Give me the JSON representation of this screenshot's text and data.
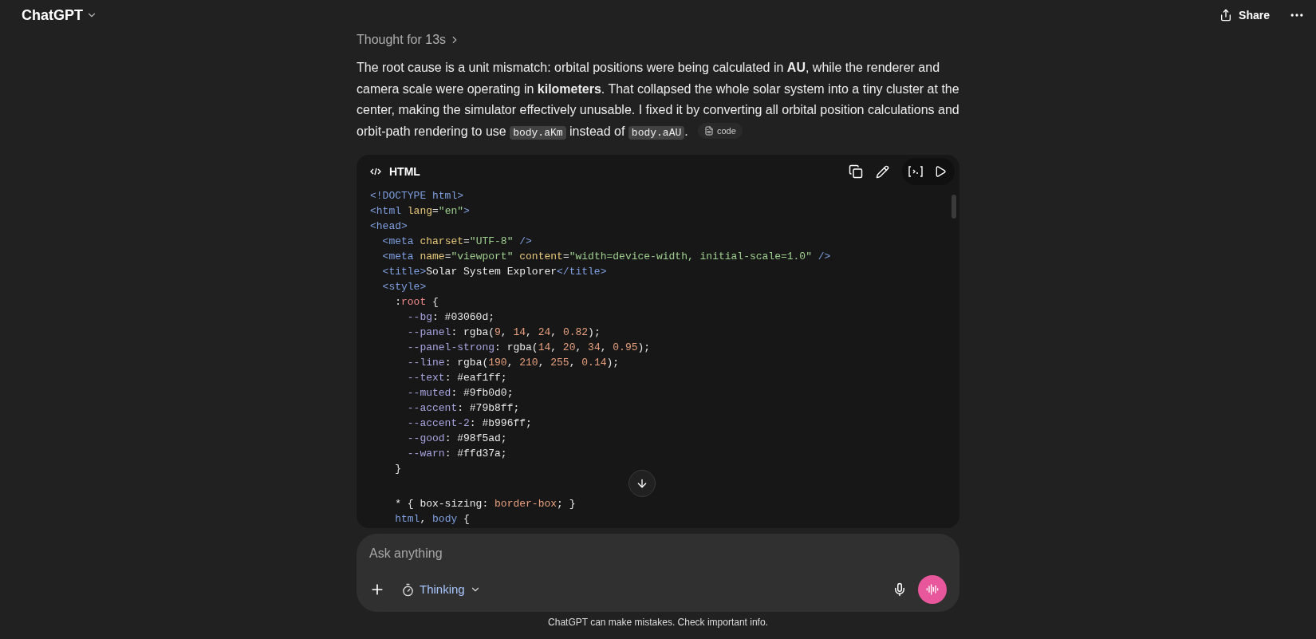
{
  "header": {
    "title": "ChatGPT",
    "share_label": "Share"
  },
  "thought": {
    "label": "Thought for 13s"
  },
  "answer": {
    "segments": [
      {
        "kind": "text",
        "text": "The root cause is a unit mismatch: orbital positions were being calculated in **AU**, while the renderer and camera scale were operating in **kilometers**. That collapsed the whole solar system into a tiny cluster at the center, making the simulator effectively unusable. I fixed it by converting all orbital position calculations and orbit-path rendering to use "
      },
      {
        "kind": "code",
        "text": "body.aKm"
      },
      {
        "kind": "text",
        "text": " instead of "
      },
      {
        "kind": "code",
        "text": "body.aAU"
      },
      {
        "kind": "text",
        "text": "."
      }
    ],
    "source_chip": "code"
  },
  "code_block": {
    "language": "HTML",
    "lines": [
      [
        {
          "kind": "tag",
          "t": "<!DOCTYPE html>"
        }
      ],
      [
        {
          "kind": "tag",
          "t": "<html "
        },
        {
          "kind": "attr",
          "t": "lang"
        },
        {
          "kind": "plain",
          "t": "="
        },
        {
          "kind": "str",
          "t": "\"en\""
        },
        {
          "kind": "tag",
          "t": ">"
        }
      ],
      [
        {
          "kind": "tag",
          "t": "<head>"
        }
      ],
      [
        {
          "kind": "tag",
          "t": "  <meta "
        },
        {
          "kind": "attr",
          "t": "charset"
        },
        {
          "kind": "plain",
          "t": "="
        },
        {
          "kind": "str",
          "t": "\"UTF-8\""
        },
        {
          "kind": "tag",
          "t": " />"
        }
      ],
      [
        {
          "kind": "tag",
          "t": "  <meta "
        },
        {
          "kind": "attr",
          "t": "name"
        },
        {
          "kind": "plain",
          "t": "="
        },
        {
          "kind": "str",
          "t": "\"viewport\""
        },
        {
          "kind": "attr",
          "t": " content"
        },
        {
          "kind": "plain",
          "t": "="
        },
        {
          "kind": "str",
          "t": "\"width=device-width, initial-scale=1.0\""
        },
        {
          "kind": "tag",
          "t": " />"
        }
      ],
      [
        {
          "kind": "tag",
          "t": "  <title>"
        },
        {
          "kind": "plain",
          "t": "Solar System Explorer"
        },
        {
          "kind": "tag",
          "t": "</title>"
        }
      ],
      [
        {
          "kind": "tag",
          "t": "  <style>"
        }
      ],
      [
        {
          "kind": "plain",
          "t": "    :"
        },
        {
          "kind": "sel",
          "t": "root"
        },
        {
          "kind": "plain",
          "t": " {"
        }
      ],
      [
        {
          "kind": "prop",
          "t": "      --bg"
        },
        {
          "kind": "plain",
          "t": ": #03060d;"
        }
      ],
      [
        {
          "kind": "prop",
          "t": "      --panel"
        },
        {
          "kind": "plain",
          "t": ": rgba("
        },
        {
          "kind": "num",
          "t": "9"
        },
        {
          "kind": "plain",
          "t": ", "
        },
        {
          "kind": "num",
          "t": "14"
        },
        {
          "kind": "plain",
          "t": ", "
        },
        {
          "kind": "num",
          "t": "24"
        },
        {
          "kind": "plain",
          "t": ", "
        },
        {
          "kind": "num",
          "t": "0.82"
        },
        {
          "kind": "plain",
          "t": ");"
        }
      ],
      [
        {
          "kind": "prop",
          "t": "      --panel-strong"
        },
        {
          "kind": "plain",
          "t": ": rgba("
        },
        {
          "kind": "num",
          "t": "14"
        },
        {
          "kind": "plain",
          "t": ", "
        },
        {
          "kind": "num",
          "t": "20"
        },
        {
          "kind": "plain",
          "t": ", "
        },
        {
          "kind": "num",
          "t": "34"
        },
        {
          "kind": "plain",
          "t": ", "
        },
        {
          "kind": "num",
          "t": "0.95"
        },
        {
          "kind": "plain",
          "t": ");"
        }
      ],
      [
        {
          "kind": "prop",
          "t": "      --line"
        },
        {
          "kind": "plain",
          "t": ": rgba("
        },
        {
          "kind": "num",
          "t": "190"
        },
        {
          "kind": "plain",
          "t": ", "
        },
        {
          "kind": "num",
          "t": "210"
        },
        {
          "kind": "plain",
          "t": ", "
        },
        {
          "kind": "num",
          "t": "255"
        },
        {
          "kind": "plain",
          "t": ", "
        },
        {
          "kind": "num",
          "t": "0.14"
        },
        {
          "kind": "plain",
          "t": ");"
        }
      ],
      [
        {
          "kind": "prop",
          "t": "      --text"
        },
        {
          "kind": "plain",
          "t": ": #eaf1ff;"
        }
      ],
      [
        {
          "kind": "prop",
          "t": "      --muted"
        },
        {
          "kind": "plain",
          "t": ": #9fb0d0;"
        }
      ],
      [
        {
          "kind": "prop",
          "t": "      --accent"
        },
        {
          "kind": "plain",
          "t": ": #79b8ff;"
        }
      ],
      [
        {
          "kind": "prop",
          "t": "      --accent-2"
        },
        {
          "kind": "plain",
          "t": ": #b996ff;"
        }
      ],
      [
        {
          "kind": "prop",
          "t": "      --good"
        },
        {
          "kind": "plain",
          "t": ": #98f5ad;"
        }
      ],
      [
        {
          "kind": "prop",
          "t": "      --warn"
        },
        {
          "kind": "plain",
          "t": ": #ffd37a;"
        }
      ],
      [
        {
          "kind": "plain",
          "t": "    }"
        }
      ],
      [
        {
          "kind": "blank"
        }
      ],
      [
        {
          "kind": "plain",
          "t": "    * { box-sizing: "
        },
        {
          "kind": "num",
          "t": "border-box"
        },
        {
          "kind": "plain",
          "t": "; }"
        }
      ],
      [
        {
          "kind": "tag",
          "t": "    html"
        },
        {
          "kind": "plain",
          "t": ", "
        },
        {
          "kind": "tag",
          "t": "body"
        },
        {
          "kind": "plain",
          "t": " {"
        }
      ]
    ]
  },
  "composer": {
    "placeholder": "Ask anything",
    "mode_label": "Thinking"
  },
  "disclaimer": "ChatGPT can make mistakes. Check important info."
}
